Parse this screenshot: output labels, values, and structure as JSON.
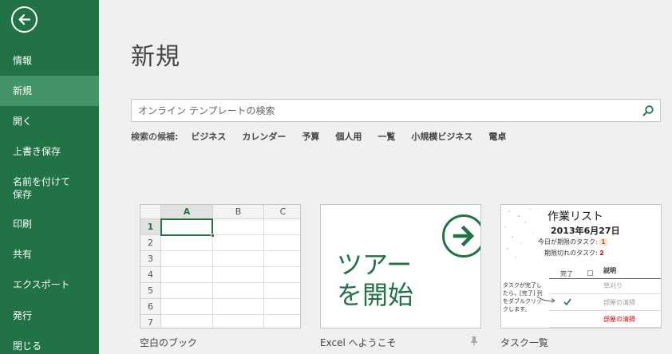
{
  "sidebar": {
    "items": [
      {
        "label": "情報"
      },
      {
        "label": "新規"
      },
      {
        "label": "開く"
      },
      {
        "label": "上書き保存"
      },
      {
        "label": "名前を付けて\n保存"
      },
      {
        "label": "印刷"
      },
      {
        "label": "共有"
      },
      {
        "label": "エクスポート"
      },
      {
        "label": "発行"
      },
      {
        "label": "閉じる"
      }
    ],
    "active_index": 1
  },
  "main": {
    "title": "新規",
    "search": {
      "placeholder": "オンライン テンプレートの検索"
    },
    "suggestions": {
      "label": "検索の候補:",
      "items": [
        "ビジネス",
        "カレンダー",
        "予算",
        "個人用",
        "一覧",
        "小規模ビジネス",
        "電卓"
      ]
    },
    "templates": [
      {
        "caption": "空白のブック",
        "columns": [
          "A",
          "B",
          "C"
        ],
        "rows": [
          "1",
          "2",
          "3",
          "4",
          "5",
          "6",
          "7"
        ]
      },
      {
        "caption": "Excel へようこそ",
        "line1": "ツアー",
        "line2": "を開始"
      },
      {
        "caption": "タスク一覧",
        "title": "作業リスト",
        "date": "2013年6月27日",
        "due_today_label": "今日が期限のタスク:",
        "due_today_value": "1",
        "overdue_label": "期限切れのタスク:",
        "overdue_value": "2",
        "col_done": "完了",
        "col_desc": "説明",
        "note": "タスクが完了したら、[完了] 列をダブルクリックします。",
        "rows": [
          {
            "text": "草刈り",
            "color": "#a0a0a0",
            "done": false
          },
          {
            "text": "部屋の清掃",
            "color": "#a0a0a0",
            "done": true
          },
          {
            "text": "部屋の清掃",
            "color": "#e00000",
            "done": false
          }
        ]
      }
    ]
  },
  "colors": {
    "accent": "#217346",
    "sidebar_active": "#439467"
  }
}
